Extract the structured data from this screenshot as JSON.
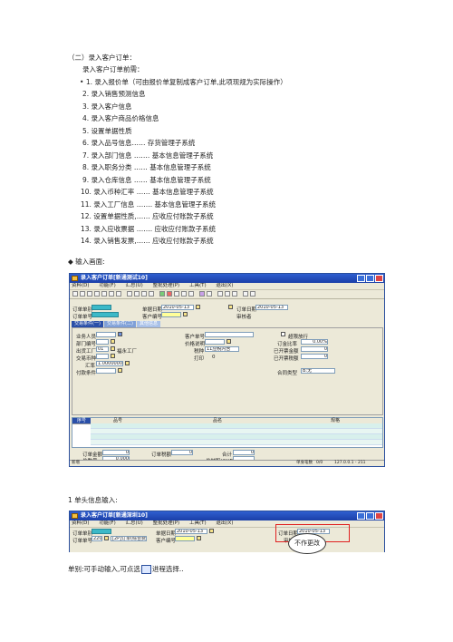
{
  "section_heading": "（二）录入客户订单：",
  "intro": "录入客户订单前需：",
  "steps": [
    "1.  录入报价单（可由报价单复制成客户订单,此项现规为实际操作）",
    "2.  录入销售预测信息",
    "3.  录入客户信息",
    "4.  录入客户商品价格信息",
    "5.  设置单据性质",
    "6.  录入品号信息……   存货管理子系统",
    "7.  录入部门信息 …….   基本信息管理子系统",
    "8.  录入职务分类 ……   基本信息管理子系统",
    "9.  录入仓库信息 ……   基本信息管理子系统",
    "10. 录入币种汇率 ……   基本信息管理子系统",
    "11. 录入工厂信息 …….   基本信息管理子系统",
    "12. 设置单据性质,……   应收应付账款子系统",
    "13. 录入应收票据 …….   应收应付账款子系统",
    "14. 录入销售发票,……   应收应付账款子系统"
  ],
  "bullet_heading": "输入画面:",
  "window1": {
    "title": "录入客户订单[新通测试10]",
    "menus": [
      "资料(D)",
      "功能(F)",
      "汇总(U)",
      "整批处理(P)",
      "工具(T)",
      "退出(X)"
    ],
    "header": {
      "order_type_label": "订单单别",
      "order_no_label": "订单单号",
      "order_date_label": "单据日期",
      "order_date_value": "2010-05-13",
      "customer_no_label": "客户编号",
      "input_date_label": "订单日期",
      "input_date_value": "2010-05-13",
      "reviewer_label": "审核者"
    },
    "tabs": [
      "交易条件(一)",
      "交易条件(二)",
      "其他信息"
    ],
    "form": {
      "salesperson_label": "业务人员",
      "dept_label": "部门编号",
      "factory_label": "出货工厂",
      "factory_code": "01",
      "factory_name": "福永工厂",
      "currency_label": "交易币种",
      "exchange_label": "汇率",
      "exchange_value": "1.0000000",
      "payment_label": "付款条件",
      "customer_order_label": "客户单号",
      "price_desc_label": "价格说明",
      "tax_label": "税种",
      "tax_value": "11应税内含",
      "print_label": "打印",
      "print_value": "0",
      "overdue_label": "超限放行",
      "order_rate_label": "订金比率",
      "order_rate_value": "0.00%",
      "deposit_label": "已开票金额",
      "deposit_value": "0",
      "receipt_label": "已开票税额",
      "receipt_value": "0",
      "contract_label": "合同类型",
      "contract_value": "B:无"
    },
    "grid_cols": [
      "序号",
      "品号",
      "品名",
      "规格"
    ],
    "footer": {
      "amount_label": "订单金额",
      "amount_value": "0",
      "tax_amt_label": "订单税额",
      "tax_amt_value": "0",
      "total_label": "合计",
      "total_value": "0",
      "qty_label": "总数量",
      "qty_value": "0.000",
      "pkg_label": "总材积(CUFT)",
      "status_left": "新增",
      "status_right": "单身笔数",
      "status_count": "0/0",
      "status_ip": "127.0.0.1 - 211"
    }
  },
  "section2_heading": "1  单头信息输入:",
  "window2": {
    "title": "录入客户订单[新通深圳10]",
    "menus": [
      "资料(D)",
      "功能(F)",
      "汇总(U)",
      "整批处理(P)",
      "工具(T)",
      "退出(X)"
    ],
    "order_type_label": "订单单别",
    "order_no_label": "订单单号",
    "order_type_value": "2201",
    "order_no_value": "[2P]订单(综合费用)",
    "order_date_label": "单据日期",
    "order_date_value": "2010-05-13",
    "customer_no_label": "客户编号",
    "input_date_label": "订单日期",
    "input_date_value": "2010-05-13",
    "reviewer_label": "审核者",
    "bubble_text": "不作更改"
  },
  "footer_note": "单别:可手动输入,可点选",
  "footer_note_end": "进程选择.."
}
